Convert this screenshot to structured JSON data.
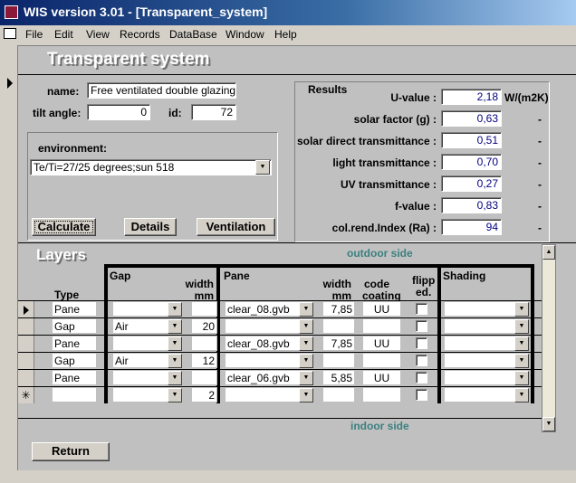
{
  "window": {
    "title": "WIS version 3.01 - [Transparent_system]"
  },
  "menu": [
    "File",
    "Edit",
    "View",
    "Records",
    "DataBase",
    "Window",
    "Help"
  ],
  "form": {
    "title": "Transparent system",
    "name_label": "name:",
    "name_value": "Free ventilated double glazing",
    "tilt_label": "tilt angle:",
    "tilt_value": "0",
    "id_label": "id:",
    "id_value": "72",
    "environment_label": "environment:",
    "environment_value": "Te/Ti=27/25 degrees;sun 518",
    "buttons": {
      "calculate": "Calculate",
      "details": "Details",
      "ventilation": "Ventilation",
      "return": "Return"
    }
  },
  "results": {
    "title": "Results",
    "rows": [
      {
        "label": "U-value :",
        "value": "2,18",
        "unit": "W/(m2K)"
      },
      {
        "label": "solar factor (g) :",
        "value": "0,63",
        "unit": "-"
      },
      {
        "label": "solar direct transmittance :",
        "value": "0,51",
        "unit": "-"
      },
      {
        "label": "light  transmittance :",
        "value": "0,70",
        "unit": "-"
      },
      {
        "label": "UV transmittance :",
        "value": "0,27",
        "unit": "-"
      },
      {
        "label": "f-value :",
        "value": "0,83",
        "unit": "-"
      },
      {
        "label": "col.rend.Index (Ra) :",
        "value": "94",
        "unit": "-"
      }
    ]
  },
  "layers": {
    "title": "Layers",
    "outdoor": "outdoor side",
    "indoor": "indoor side",
    "headers": {
      "type": "Type",
      "gap": "Gap",
      "gap_width": "width",
      "gap_width_unit": "mm",
      "pane": "Pane",
      "pane_width": "width",
      "pane_width_unit": "mm",
      "code": "code",
      "coating": "coating",
      "flipped1": "flipp",
      "flipped2": "ed.",
      "shading": "Shading"
    },
    "rows": [
      {
        "selector": "current",
        "type": "Pane",
        "gas": "",
        "gap_width": "",
        "pane": "clear_08.gvb",
        "pane_width": "7,85",
        "code": "UU",
        "flipped": false,
        "shading": ""
      },
      {
        "selector": "",
        "type": "Gap",
        "gas": "Air",
        "gap_width": "20",
        "pane": "",
        "pane_width": "",
        "code": "",
        "flipped": false,
        "shading": ""
      },
      {
        "selector": "",
        "type": "Pane",
        "gas": "",
        "gap_width": "",
        "pane": "clear_08.gvb",
        "pane_width": "7,85",
        "code": "UU",
        "flipped": false,
        "shading": ""
      },
      {
        "selector": "",
        "type": "Gap",
        "gas": "Air",
        "gap_width": "12",
        "pane": "",
        "pane_width": "",
        "code": "",
        "flipped": false,
        "shading": ""
      },
      {
        "selector": "",
        "type": "Pane",
        "gas": "",
        "gap_width": "",
        "pane": "clear_06.gvb",
        "pane_width": "5,85",
        "code": "UU",
        "flipped": false,
        "shading": ""
      },
      {
        "selector": "new",
        "type": "",
        "gas": "",
        "gap_width": "2",
        "pane": "",
        "pane_width": "",
        "code": "",
        "flipped": false,
        "shading": ""
      }
    ]
  }
}
